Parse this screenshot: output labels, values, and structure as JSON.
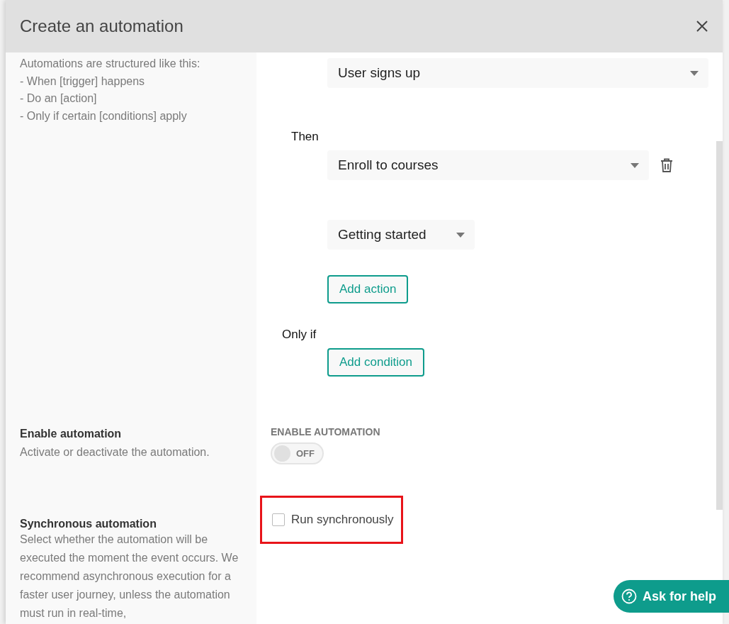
{
  "dialog": {
    "title": "Create an automation"
  },
  "intro": [
    "Automations are structured like this:",
    "- When [trigger] happens",
    "- Do an [action]",
    "- Only if certain [conditions] apply"
  ],
  "trigger": {
    "value": "User signs up"
  },
  "then_label": "Then",
  "actions": [
    {
      "value": "Enroll to courses",
      "sub_value": "Getting started"
    }
  ],
  "add_action": "Add action",
  "only_if_label": "Only if",
  "add_condition": "Add condition",
  "enable": {
    "title": "Enable automation",
    "description": "Activate or deactivate the automation.",
    "field_label": "ENABLE AUTOMATION",
    "toggle": {
      "on": false,
      "label": "OFF"
    }
  },
  "sync": {
    "title": "Synchronous automation",
    "description": "Select whether the automation will be executed the moment the event occurs. We recommend asynchronous execution for a faster user journey, unless the automation must run in real-time,",
    "checkbox": {
      "label": "Run synchronously",
      "checked": false,
      "highlighted": true
    }
  },
  "help_button": "Ask for help"
}
